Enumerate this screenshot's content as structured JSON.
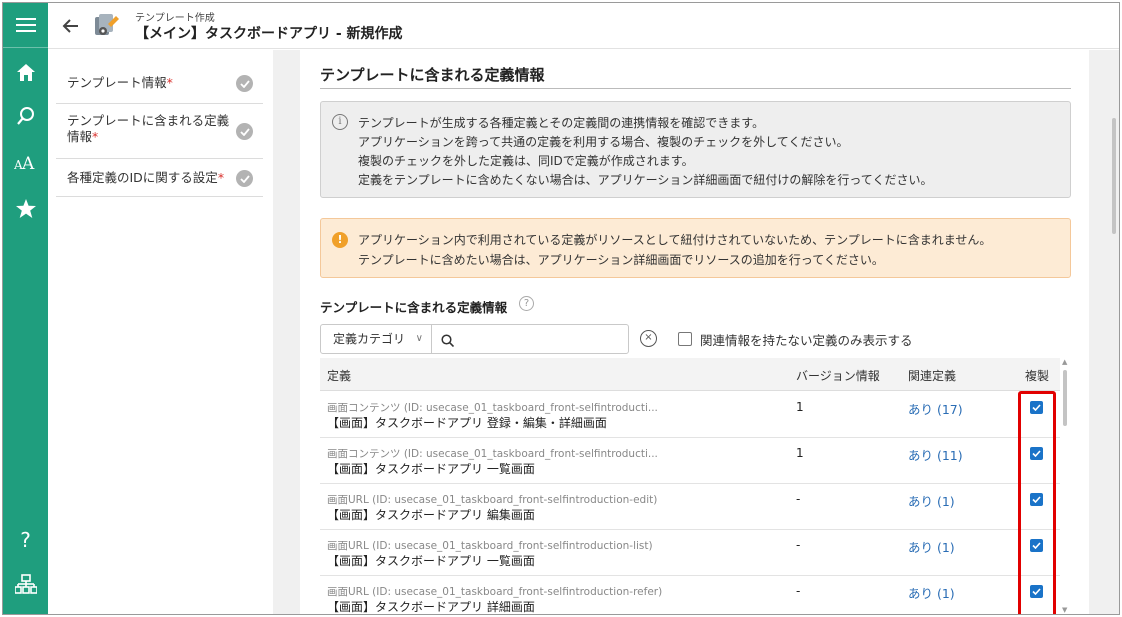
{
  "colors": {
    "rail": "#1f9e7e",
    "accent_link": "#2a6db5",
    "checkbox": "#1a73c8",
    "highlight": "#e10000",
    "required": "#d9302c",
    "warning": "#f0a02a"
  },
  "rail": {
    "icons": [
      "menu-icon",
      "home-icon",
      "search-icon",
      "font-size-icon",
      "star-icon",
      "help-icon",
      "sitemap-icon"
    ],
    "help_glyph": "?"
  },
  "header": {
    "breadcrumb": "テンプレート作成",
    "title": "【メイン】タスクボードアプリ - 新規作成"
  },
  "leftnav": {
    "items": [
      {
        "label": "テンプレート情報",
        "required": "*",
        "done": true
      },
      {
        "label_line1": "テンプレートに含まれる定義",
        "label_line2": "情報",
        "required": "*",
        "done": true
      },
      {
        "label": "各種定義のIDに関する設定",
        "required": "*",
        "done": true
      }
    ]
  },
  "section": {
    "title": "テンプレートに含まれる定義情報",
    "info_lines": [
      "テンプレートが生成する各種定義とその定義間の連携情報を確認できます。",
      "アプリケーションを跨って共通の定義を利用する場合、複製のチェックを外してください。",
      "複製のチェックを外した定義は、同IDで定義が作成されます。",
      "定義をテンプレートに含めたくない場合は、アプリケーション詳細画面で紐付けの解除を行ってください。"
    ],
    "warning_lines": [
      "アプリケーション内で利用されている定義がリソースとして紐付けされていないため、テンプレートに含まれません。",
      "テンプレートに含めたい場合は、アプリケーション詳細画面でリソースの追加を行ってください。"
    ],
    "info_glyph": "i",
    "warning_glyph": "!"
  },
  "list": {
    "title": "テンプレートに含まれる定義情報",
    "help_glyph": "?",
    "filter": {
      "category": "定義カテゴリ",
      "category_chevron": "∨",
      "search_value": "",
      "search_placeholder": "",
      "clear_glyph": "×"
    },
    "only_unrelated_label": "関連情報を持たない定義のみ表示する",
    "only_unrelated_checked": false,
    "columns": {
      "definition": "定義",
      "version": "バージョン情報",
      "related": "関連定義",
      "duplicate": "複製"
    },
    "scroll_up": "▲",
    "scroll_down": "▼",
    "rows": [
      {
        "id_text": "画面コンテンツ (ID: usecase_01_taskboard_front-selfintroducti...",
        "name": "【画面】タスクボードアプリ 登録・編集・詳細画面",
        "version": "1",
        "related": "あり (17)",
        "duplicate": true
      },
      {
        "id_text": "画面コンテンツ (ID: usecase_01_taskboard_front-selfintroducti...",
        "name": "【画面】タスクボードアプリ 一覧画面",
        "version": "1",
        "related": "あり (11)",
        "duplicate": true
      },
      {
        "id_text": "画面URL (ID: usecase_01_taskboard_front-selfintroduction-edit)",
        "name": "【画面】タスクボードアプリ 編集画面",
        "version": "-",
        "related": "あり (1)",
        "duplicate": true
      },
      {
        "id_text": "画面URL (ID: usecase_01_taskboard_front-selfintroduction-list)",
        "name": "【画面】タスクボードアプリ 一覧画面",
        "version": "-",
        "related": "あり (1)",
        "duplicate": true
      },
      {
        "id_text": "画面URL (ID: usecase_01_taskboard_front-selfintroduction-refer)",
        "name": "【画面】タスクボードアプリ 詳細画面",
        "version": "-",
        "related": "あり (1)",
        "duplicate": true
      }
    ]
  }
}
